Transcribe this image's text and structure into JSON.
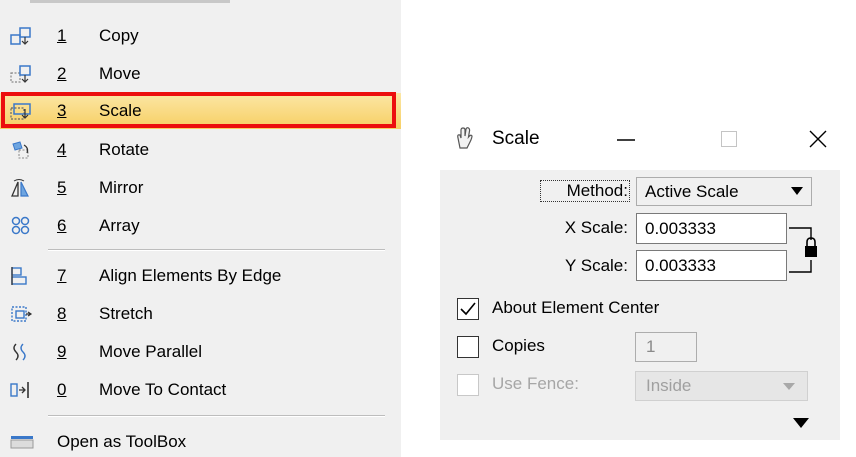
{
  "menu": {
    "items": [
      {
        "num": "1",
        "label": "Copy",
        "icon": "copy-icon"
      },
      {
        "num": "2",
        "label": "Move",
        "icon": "move-icon"
      },
      {
        "num": "3",
        "label": "Scale",
        "icon": "scale-icon",
        "highlighted": true
      },
      {
        "num": "4",
        "label": "Rotate",
        "icon": "rotate-icon"
      },
      {
        "num": "5",
        "label": "Mirror",
        "icon": "mirror-icon"
      },
      {
        "num": "6",
        "label": "Array",
        "icon": "array-icon"
      },
      {
        "num": "7",
        "label": "Align Elements By Edge",
        "icon": "align-icon"
      },
      {
        "num": "8",
        "label": "Stretch",
        "icon": "stretch-icon"
      },
      {
        "num": "9",
        "label": "Move Parallel",
        "icon": "move-parallel-icon"
      },
      {
        "num": "0",
        "label": "Move To Contact",
        "icon": "move-to-contact-icon"
      }
    ],
    "toolbox_label": "Open as ToolBox",
    "highlight_color": "#ec0e0e"
  },
  "dialog": {
    "title": "Scale",
    "method_label": "Method:",
    "method_value": "Active Scale",
    "x_scale_label": "X Scale:",
    "x_scale_value": "0.003333",
    "y_scale_label": "Y Scale:",
    "y_scale_value": "0.003333",
    "about_center_label": "About Element Center",
    "about_center_checked": true,
    "copies_label": "Copies",
    "copies_checked": false,
    "copies_value": "1",
    "use_fence_label": "Use Fence:",
    "use_fence_checked": false,
    "fence_value": "Inside"
  }
}
